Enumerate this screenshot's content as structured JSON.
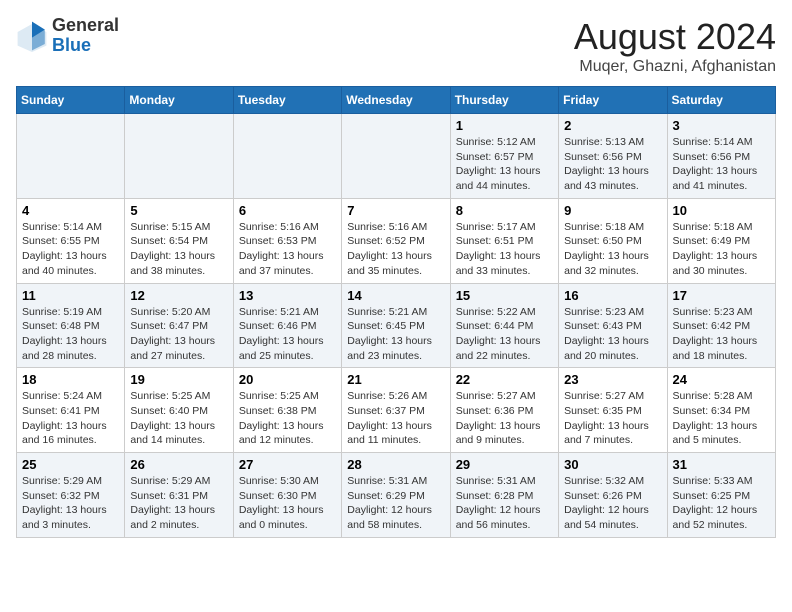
{
  "logo": {
    "general": "General",
    "blue": "Blue"
  },
  "title": "August 2024",
  "subtitle": "Muqer, Ghazni, Afghanistan",
  "days_of_week": [
    "Sunday",
    "Monday",
    "Tuesday",
    "Wednesday",
    "Thursday",
    "Friday",
    "Saturday"
  ],
  "weeks": [
    [
      {
        "day": "",
        "info": ""
      },
      {
        "day": "",
        "info": ""
      },
      {
        "day": "",
        "info": ""
      },
      {
        "day": "",
        "info": ""
      },
      {
        "day": "1",
        "info": "Sunrise: 5:12 AM\nSunset: 6:57 PM\nDaylight: 13 hours\nand 44 minutes."
      },
      {
        "day": "2",
        "info": "Sunrise: 5:13 AM\nSunset: 6:56 PM\nDaylight: 13 hours\nand 43 minutes."
      },
      {
        "day": "3",
        "info": "Sunrise: 5:14 AM\nSunset: 6:56 PM\nDaylight: 13 hours\nand 41 minutes."
      }
    ],
    [
      {
        "day": "4",
        "info": "Sunrise: 5:14 AM\nSunset: 6:55 PM\nDaylight: 13 hours\nand 40 minutes."
      },
      {
        "day": "5",
        "info": "Sunrise: 5:15 AM\nSunset: 6:54 PM\nDaylight: 13 hours\nand 38 minutes."
      },
      {
        "day": "6",
        "info": "Sunrise: 5:16 AM\nSunset: 6:53 PM\nDaylight: 13 hours\nand 37 minutes."
      },
      {
        "day": "7",
        "info": "Sunrise: 5:16 AM\nSunset: 6:52 PM\nDaylight: 13 hours\nand 35 minutes."
      },
      {
        "day": "8",
        "info": "Sunrise: 5:17 AM\nSunset: 6:51 PM\nDaylight: 13 hours\nand 33 minutes."
      },
      {
        "day": "9",
        "info": "Sunrise: 5:18 AM\nSunset: 6:50 PM\nDaylight: 13 hours\nand 32 minutes."
      },
      {
        "day": "10",
        "info": "Sunrise: 5:18 AM\nSunset: 6:49 PM\nDaylight: 13 hours\nand 30 minutes."
      }
    ],
    [
      {
        "day": "11",
        "info": "Sunrise: 5:19 AM\nSunset: 6:48 PM\nDaylight: 13 hours\nand 28 minutes."
      },
      {
        "day": "12",
        "info": "Sunrise: 5:20 AM\nSunset: 6:47 PM\nDaylight: 13 hours\nand 27 minutes."
      },
      {
        "day": "13",
        "info": "Sunrise: 5:21 AM\nSunset: 6:46 PM\nDaylight: 13 hours\nand 25 minutes."
      },
      {
        "day": "14",
        "info": "Sunrise: 5:21 AM\nSunset: 6:45 PM\nDaylight: 13 hours\nand 23 minutes."
      },
      {
        "day": "15",
        "info": "Sunrise: 5:22 AM\nSunset: 6:44 PM\nDaylight: 13 hours\nand 22 minutes."
      },
      {
        "day": "16",
        "info": "Sunrise: 5:23 AM\nSunset: 6:43 PM\nDaylight: 13 hours\nand 20 minutes."
      },
      {
        "day": "17",
        "info": "Sunrise: 5:23 AM\nSunset: 6:42 PM\nDaylight: 13 hours\nand 18 minutes."
      }
    ],
    [
      {
        "day": "18",
        "info": "Sunrise: 5:24 AM\nSunset: 6:41 PM\nDaylight: 13 hours\nand 16 minutes."
      },
      {
        "day": "19",
        "info": "Sunrise: 5:25 AM\nSunset: 6:40 PM\nDaylight: 13 hours\nand 14 minutes."
      },
      {
        "day": "20",
        "info": "Sunrise: 5:25 AM\nSunset: 6:38 PM\nDaylight: 13 hours\nand 12 minutes."
      },
      {
        "day": "21",
        "info": "Sunrise: 5:26 AM\nSunset: 6:37 PM\nDaylight: 13 hours\nand 11 minutes."
      },
      {
        "day": "22",
        "info": "Sunrise: 5:27 AM\nSunset: 6:36 PM\nDaylight: 13 hours\nand 9 minutes."
      },
      {
        "day": "23",
        "info": "Sunrise: 5:27 AM\nSunset: 6:35 PM\nDaylight: 13 hours\nand 7 minutes."
      },
      {
        "day": "24",
        "info": "Sunrise: 5:28 AM\nSunset: 6:34 PM\nDaylight: 13 hours\nand 5 minutes."
      }
    ],
    [
      {
        "day": "25",
        "info": "Sunrise: 5:29 AM\nSunset: 6:32 PM\nDaylight: 13 hours\nand 3 minutes."
      },
      {
        "day": "26",
        "info": "Sunrise: 5:29 AM\nSunset: 6:31 PM\nDaylight: 13 hours\nand 2 minutes."
      },
      {
        "day": "27",
        "info": "Sunrise: 5:30 AM\nSunset: 6:30 PM\nDaylight: 13 hours\nand 0 minutes."
      },
      {
        "day": "28",
        "info": "Sunrise: 5:31 AM\nSunset: 6:29 PM\nDaylight: 12 hours\nand 58 minutes."
      },
      {
        "day": "29",
        "info": "Sunrise: 5:31 AM\nSunset: 6:28 PM\nDaylight: 12 hours\nand 56 minutes."
      },
      {
        "day": "30",
        "info": "Sunrise: 5:32 AM\nSunset: 6:26 PM\nDaylight: 12 hours\nand 54 minutes."
      },
      {
        "day": "31",
        "info": "Sunrise: 5:33 AM\nSunset: 6:25 PM\nDaylight: 12 hours\nand 52 minutes."
      }
    ]
  ]
}
